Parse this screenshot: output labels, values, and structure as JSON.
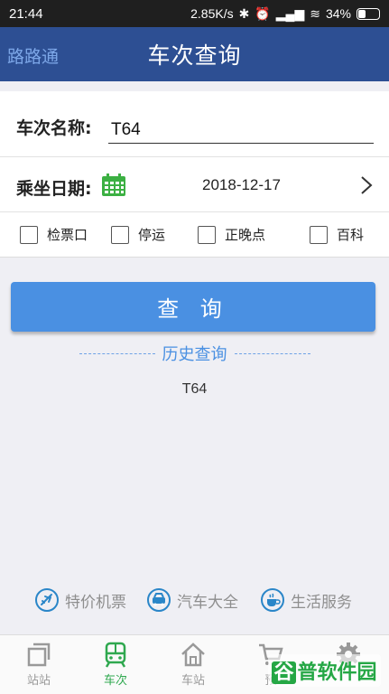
{
  "status_bar": {
    "time": "21:44",
    "speed": "2.85K/s",
    "battery": "34%"
  },
  "header": {
    "brand": "路路通",
    "title": "车次查询"
  },
  "form": {
    "train_label": "车次名称:",
    "train_value": "T64",
    "date_label": "乘坐日期:",
    "date_value": "2018-12-17",
    "options": [
      "检票口",
      "停运",
      "正晚点",
      "百科"
    ]
  },
  "query_button": "查 询",
  "history": {
    "title": "历史查询",
    "items": [
      "T64"
    ]
  },
  "services": [
    {
      "label": "特价机票",
      "icon": "plane-icon"
    },
    {
      "label": "汽车大全",
      "icon": "car-icon"
    },
    {
      "label": "生活服务",
      "icon": "coffee-icon"
    }
  ],
  "bottom_nav": [
    {
      "label": "站站",
      "icon": "station-pair-icon",
      "active": false
    },
    {
      "label": "车次",
      "icon": "train-icon",
      "active": true
    },
    {
      "label": "车站",
      "icon": "home-station-icon",
      "active": false
    },
    {
      "label": "预",
      "icon": "cart-icon",
      "active": false
    },
    {
      "label": "",
      "icon": "gear-icon",
      "active": false
    }
  ],
  "watermark": {
    "first_char": "谷",
    "rest": "普软件园"
  },
  "colors": {
    "header": "#2d4f93",
    "accent": "#4a90e2",
    "nav_active": "#2fa84f",
    "calendar": "#3cb043"
  }
}
